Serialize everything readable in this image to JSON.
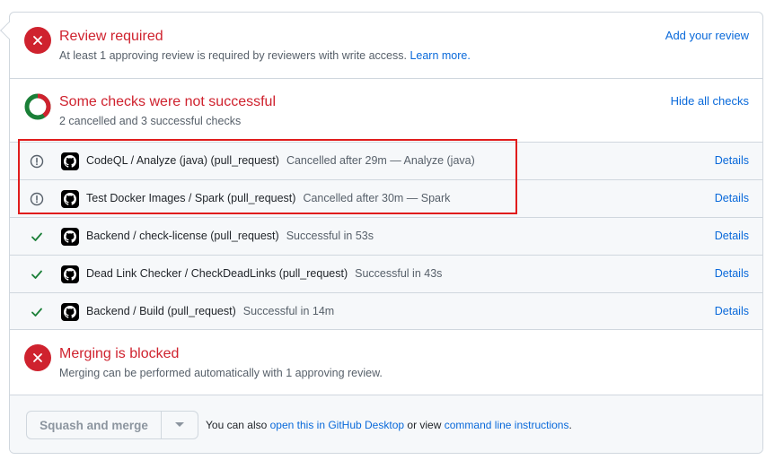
{
  "review": {
    "title": "Review required",
    "subtitle": "At least 1 approving review is required by reviewers with write access.",
    "learn_more": "Learn more.",
    "add_review": "Add your review"
  },
  "checks_summary": {
    "title": "Some checks were not successful",
    "subtitle": "2 cancelled and 3 successful checks",
    "hide_all": "Hide all checks"
  },
  "checks": [
    {
      "status": "cancelled",
      "name": "CodeQL / Analyze (java) (pull_request)",
      "description": "Cancelled after 29m — Analyze (java)",
      "details": "Details"
    },
    {
      "status": "cancelled",
      "name": "Test Docker Images / Spark (pull_request)",
      "description": "Cancelled after 30m — Spark",
      "details": "Details"
    },
    {
      "status": "success",
      "name": "Backend / check-license (pull_request)",
      "description": "Successful in 53s",
      "details": "Details"
    },
    {
      "status": "success",
      "name": "Dead Link Checker / CheckDeadLinks (pull_request)",
      "description": "Successful in 43s",
      "details": "Details"
    },
    {
      "status": "success",
      "name": "Backend / Build (pull_request)",
      "description": "Successful in 14m",
      "details": "Details"
    }
  ],
  "merge": {
    "title": "Merging is blocked",
    "subtitle": "Merging can be performed automatically with 1 approving review."
  },
  "action": {
    "button_label": "Squash and merge",
    "text_prefix": "You can also",
    "desktop_link": "open this in GitHub Desktop",
    "text_middle": "or view",
    "cli_link": "command line instructions",
    "text_suffix": "."
  },
  "colors": {
    "danger": "#cf222e",
    "success": "#1a7f37",
    "link": "#0969da",
    "highlight": "#e01c1c"
  }
}
